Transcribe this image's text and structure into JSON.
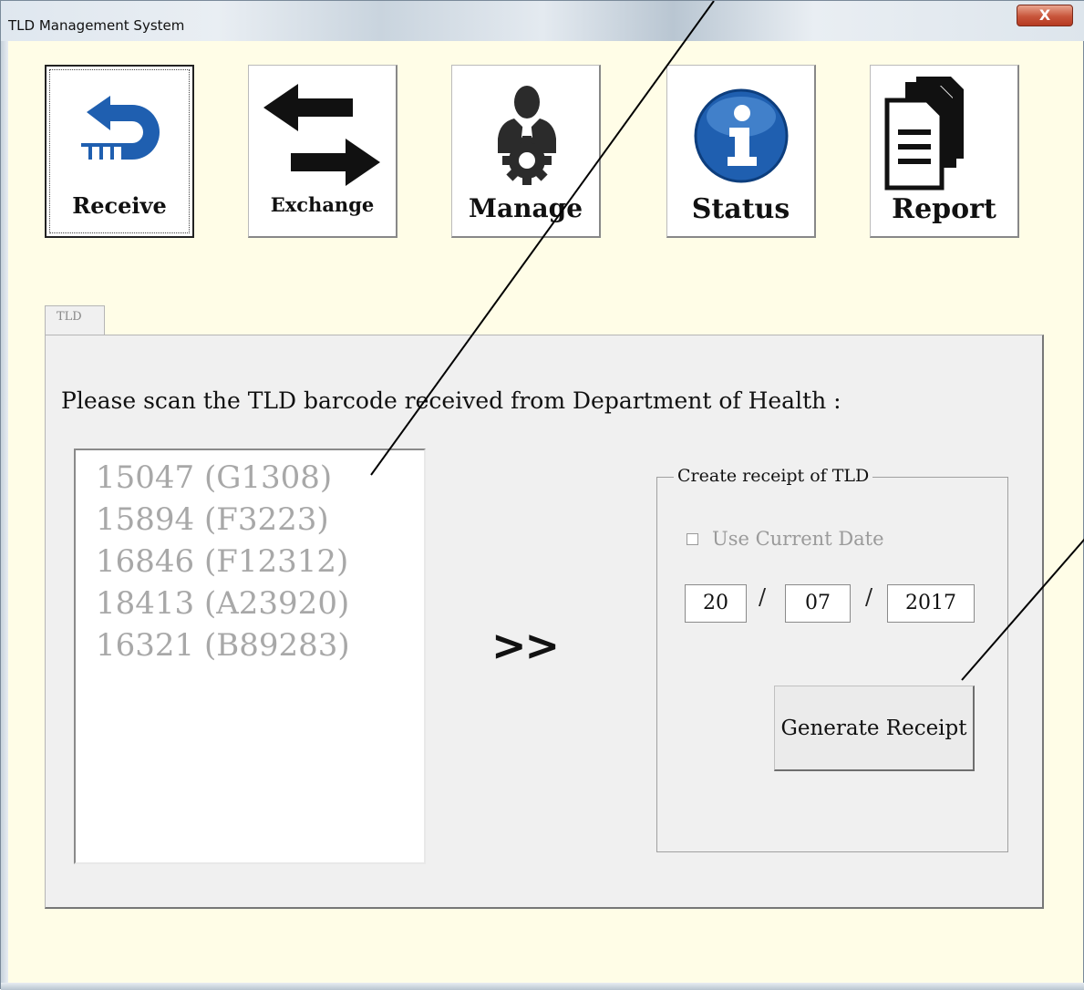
{
  "window": {
    "title": "TLD Management System",
    "close_label": "X"
  },
  "toolbar": {
    "receive": "Receive",
    "exchange": "Exchange",
    "manage": "Manage",
    "status": "Status",
    "report": "Report"
  },
  "tab": {
    "label": "TLD"
  },
  "panel": {
    "instruction": "Please scan the TLD barcode received from Department of Health :",
    "scanned_items": [
      "15047 (G1308)",
      "15894 (F3223)",
      "16846 (F12312)",
      "18413 (A23920)",
      "16321 (B89283)"
    ],
    "arrow_glyph": ">>"
  },
  "receipt": {
    "group_title": "Create receipt of TLD",
    "use_current_date_label": "Use Current Date",
    "use_current_date_checked": false,
    "day": "20",
    "month": "07",
    "year": "2017",
    "separator": "/",
    "generate_label": "Generate Receipt"
  },
  "colors": {
    "window_bg": "#fffde7",
    "panel_bg": "#f0f0f0",
    "disabled_text": "#a8a8a8",
    "icon_blue": "#1f5fb0"
  }
}
